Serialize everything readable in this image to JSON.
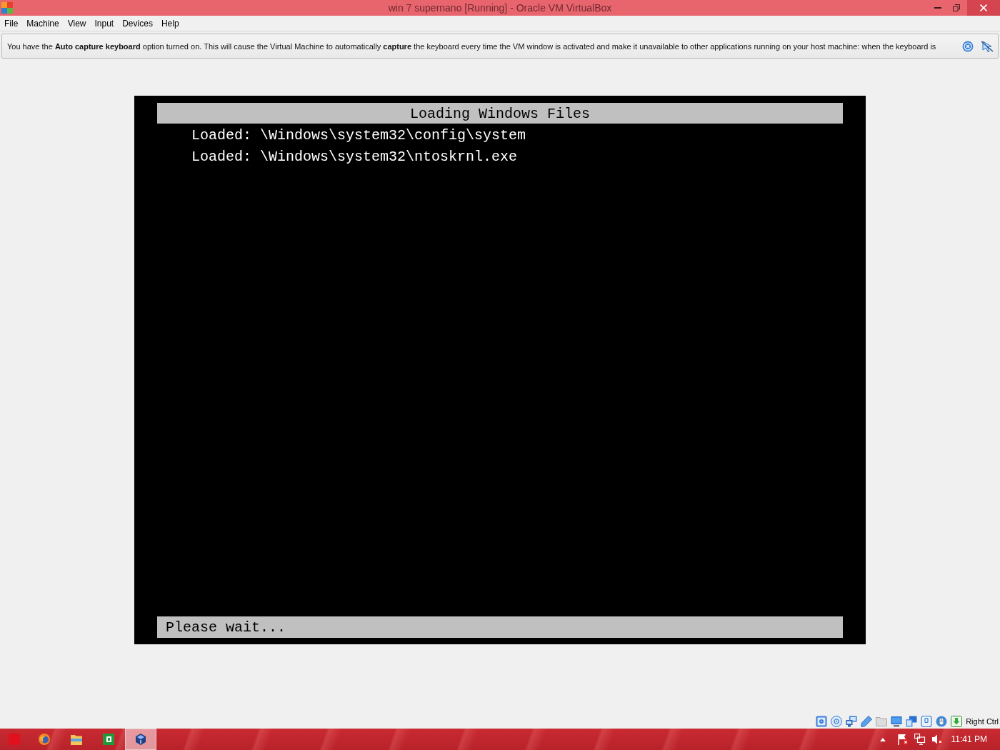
{
  "window": {
    "title": "win 7 supernano [Running] - Oracle VM VirtualBox"
  },
  "menu": [
    "File",
    "Machine",
    "View",
    "Input",
    "Devices",
    "Help"
  ],
  "notice": {
    "text": "You have the **Auto capture keyboard** option turned on. This will cause the Virtual Machine to automatically **capture** the keyboard every time the VM window is activated and make it unavailable to other applications running on your host machine: when the keyboard is"
  },
  "vm_screen": {
    "header": "Loading Windows Files",
    "lines": [
      "Loaded: \\Windows\\system32\\config\\system",
      "Loaded: \\Windows\\system32\\ntoskrnl.exe"
    ],
    "footer": "Please wait..."
  },
  "status_bar": {
    "host_key": "Right Ctrl"
  },
  "taskbar": {
    "apps": [
      {
        "kind": "browser",
        "selected": false
      },
      {
        "kind": "folder",
        "selected": false
      },
      {
        "kind": "office",
        "selected": false
      },
      {
        "kind": "vbox",
        "selected": true
      }
    ],
    "clock": "11:41 PM"
  }
}
